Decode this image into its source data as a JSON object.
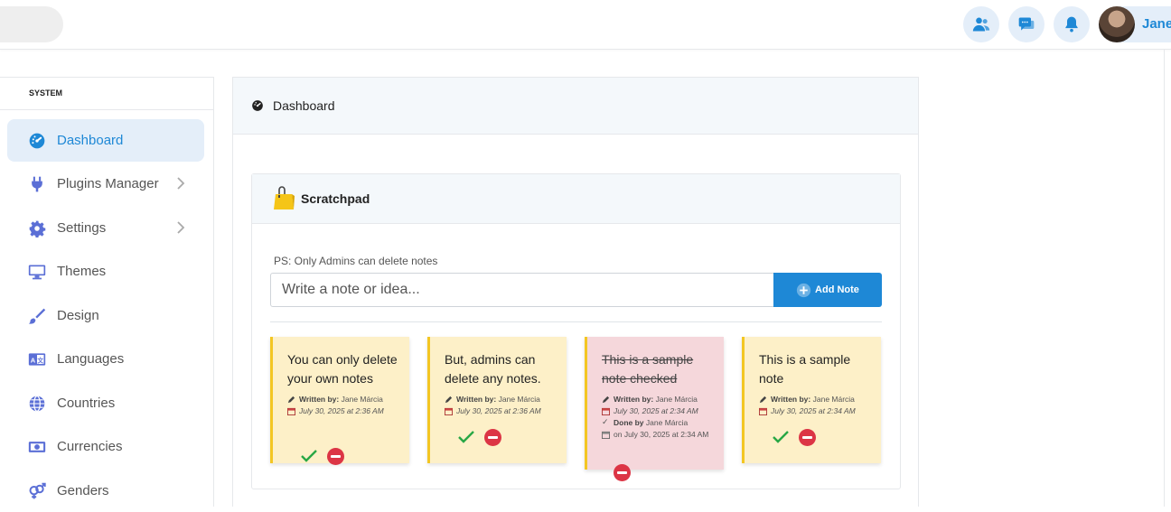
{
  "header": {
    "user_name": "Jane",
    "icons": [
      "users-icon",
      "chat-icon",
      "bell-icon"
    ]
  },
  "sidebar": {
    "section": "SYSTEM",
    "items": [
      {
        "label": "Dashboard",
        "icon": "dashboard-gauge-icon",
        "active": true
      },
      {
        "label": "Plugins Manager",
        "icon": "plug-icon",
        "submenu": true
      },
      {
        "label": "Settings",
        "icon": "gear-icon",
        "submenu": true
      },
      {
        "label": "Themes",
        "icon": "monitor-icon"
      },
      {
        "label": "Design",
        "icon": "paintbrush-icon"
      },
      {
        "label": "Languages",
        "icon": "language-icon"
      },
      {
        "label": "Countries",
        "icon": "globe-icon"
      },
      {
        "label": "Currencies",
        "icon": "money-bill-icon"
      },
      {
        "label": "Genders",
        "icon": "genders-icon"
      }
    ]
  },
  "main": {
    "title": "Dashboard",
    "scratchpad": {
      "title": "Scratchpad",
      "ps": "PS: Only Admins can delete notes",
      "input_placeholder": "Write a note or idea...",
      "add_label": "Add Note",
      "notes": [
        {
          "text": "You can only delete your own notes",
          "written_by_label": "Written by:",
          "author": "Jane Márcia",
          "date": "July 30, 2025 at 2:36 AM",
          "checked": false
        },
        {
          "text": "But, admins can delete any notes.",
          "written_by_label": "Written by:",
          "author": "Jane Márcia",
          "date": "July 30, 2025 at 2:36 AM",
          "checked": false
        },
        {
          "text": "This is a sample note checked",
          "written_by_label": "Written by:",
          "author": "Jane Márcia",
          "date": "July 30, 2025 at 2:34 AM",
          "checked": true,
          "done_by_label": "Done by",
          "done_by": "Jane Márcia",
          "done_date": "on July 30, 2025 at 2:34 AM"
        },
        {
          "text": "This is a sample note",
          "written_by_label": "Written by:",
          "author": "Jane Márcia",
          "date": "July 30, 2025 at 2:34 AM",
          "checked": false
        }
      ]
    }
  },
  "colors": {
    "accent": "#1e88d6",
    "note_bg": "#fdf0c8",
    "note_checked_bg": "#f5d7db",
    "note_border": "#f3c623",
    "check_green": "#28a745",
    "delete_red": "#dc3545"
  }
}
